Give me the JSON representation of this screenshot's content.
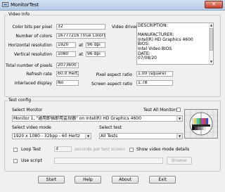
{
  "window": {
    "title": "MonitorTest",
    "close_glyph": "✕"
  },
  "video_info": {
    "legend": "Video Info",
    "color_bits_label": "Color bits per pixel",
    "color_bits_value": "32",
    "num_colors_label": "Number of colors",
    "num_colors_value": "16777216 (True Color)",
    "h_res_label": "Horizontal resolution",
    "h_res_value": "1920",
    "h_at": "at",
    "h_dpi": "96 dpi",
    "v_res_label": "Vertical resolution",
    "v_res_value": "1080",
    "v_at": "at",
    "v_dpi": "96 dpi",
    "total_pixels_label": "Total number of pixels",
    "total_pixels_value": "2073600",
    "refresh_label": "Refresh rate",
    "refresh_value": "60.0 Hertz",
    "interlaced_label": "Interlaced display",
    "interlaced_value": "No",
    "driver_label": "Video driver",
    "driver_lines": [
      "DESCRIPTION:",
      "",
      "MANUFACTURER:",
      "Intel(R) HD Graphics 4600",
      "BIOS:",
      "Intel Video BIOS",
      "DATE:",
      "07/08/20"
    ],
    "pixel_aspect_label": "Pixel aspect ratio",
    "pixel_aspect_value": "1.00 (square)",
    "screen_aspect_label": "Screen aspect ratio",
    "screen_aspect_value": "1.78"
  },
  "test_config": {
    "legend": "Test config",
    "select_monitor_label": "Select Monitor",
    "monitor_value": "Monitor 1, \"通用即插即用监视器\" on Intel(R) HD Graphics 4600",
    "test_all_label": "Test All Monitors",
    "video_mode_label": "Select video mode",
    "video_mode_value": "1920 x 1080 - 32bpp - 60 Hertz",
    "select_test_label": "Select test",
    "select_test_value": "All Tests",
    "loop_label": "Loop Test",
    "loop_seconds": "3",
    "loop_units": "seconds per test screen",
    "show_details_label": "Show video mode details",
    "use_script_label": "Use script",
    "browse_label": "Browse"
  },
  "buttons": {
    "start": "Start",
    "help": "Help",
    "about": "About",
    "exit": "Exit"
  },
  "icons": {
    "arrow_down": "▼",
    "arrow_up": "▲",
    "test_card": "test-card-icon"
  }
}
